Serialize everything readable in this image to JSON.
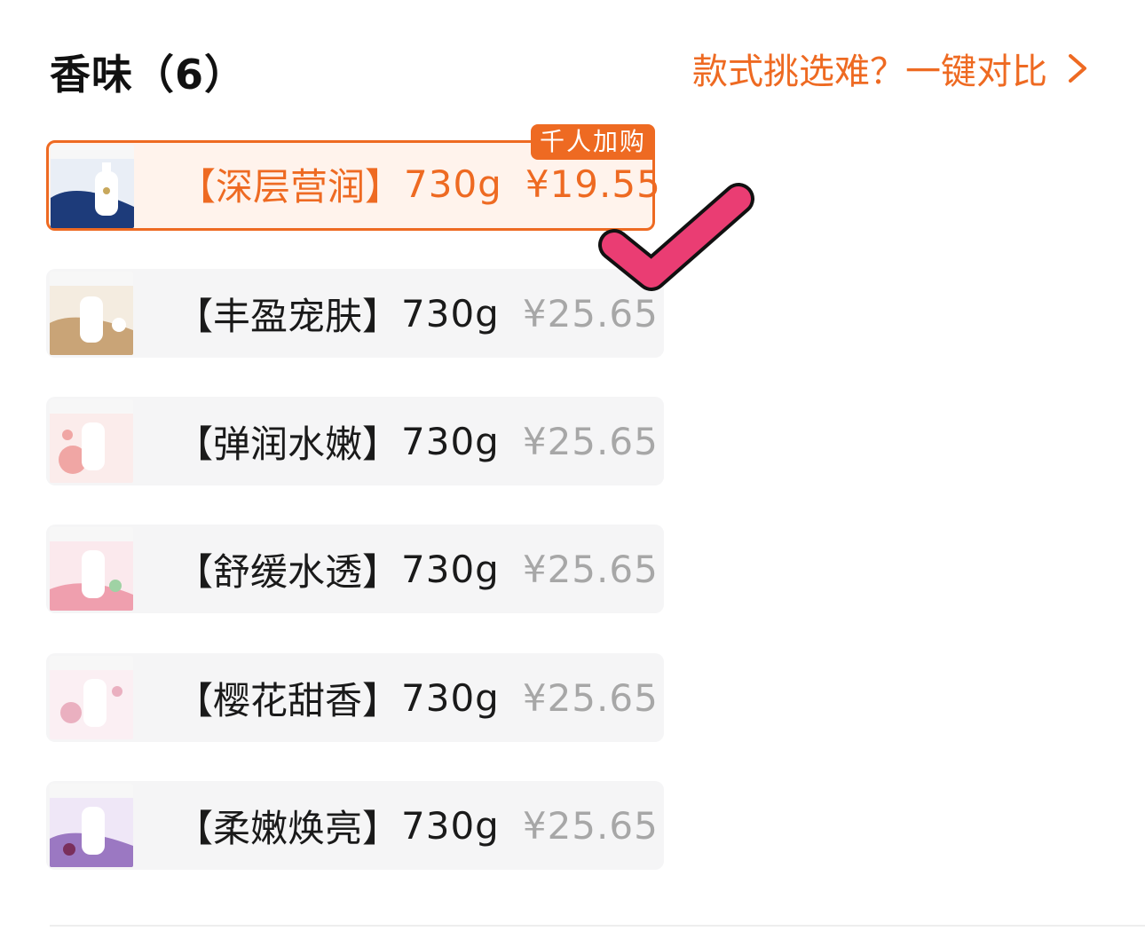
{
  "header": {
    "title": "香味（6）",
    "compare_link": "款式挑选难？一键对比"
  },
  "badge": "千人加购",
  "items": [
    {
      "name": "【深层营润】",
      "weight": "730g",
      "price": "¥19.55",
      "selected": true,
      "tone": [
        "#1d3b7a",
        "#e9eef6"
      ]
    },
    {
      "name": "【丰盈宠肤】",
      "weight": "730g",
      "price": "¥25.65",
      "selected": false,
      "tone": [
        "#c9a477",
        "#f4ece0"
      ]
    },
    {
      "name": "【弹润水嫩】",
      "weight": "730g",
      "price": "¥25.65",
      "selected": false,
      "tone": [
        "#f0a6a4",
        "#fbeceb"
      ]
    },
    {
      "name": "【舒缓水透】",
      "weight": "730g",
      "price": "¥25.65",
      "selected": false,
      "tone": [
        "#ef9fae",
        "#fbe9ed"
      ]
    },
    {
      "name": "【樱花甜香】",
      "weight": "730g",
      "price": "¥25.65",
      "selected": false,
      "tone": [
        "#eab0c0",
        "#fbeff3"
      ]
    },
    {
      "name": "【柔嫩焕亮】",
      "weight": "730g",
      "price": "¥25.65",
      "selected": false,
      "tone": [
        "#9b78c2",
        "#efe7f7"
      ]
    }
  ],
  "colors": {
    "accent": "#ee6a22",
    "check": "#ea3d73"
  },
  "icons": {
    "compare_arrow": "chevron-right-icon",
    "selection_mark": "checkmark-icon"
  }
}
